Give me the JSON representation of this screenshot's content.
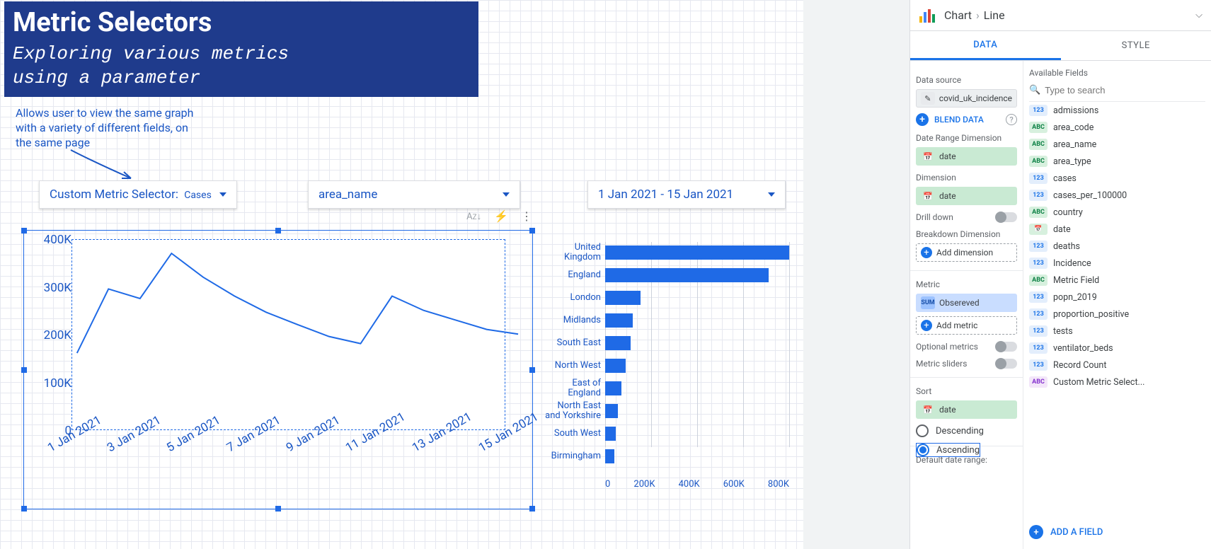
{
  "banner": {
    "title": "Metric Selectors",
    "subtitle_l1": "Exploring various metrics",
    "subtitle_l2": "using a parameter"
  },
  "note": "Allows user to view the same graph with a variety of different fields, on the same page",
  "dropdowns": {
    "metric_label": "Custom Metric Selector:",
    "metric_value": "Cases",
    "area": "area_name",
    "date_range": "1 Jan 2021 - 15 Jan 2021"
  },
  "quick_actions": {
    "sort_az": "AZ",
    "bolt": "⚡",
    "more": "⋮"
  },
  "chart_data": [
    {
      "type": "line",
      "title": "",
      "xlabel": "",
      "ylabel": "",
      "ylim": [
        0,
        400000
      ],
      "y_ticks": [
        "0",
        "100K",
        "200K",
        "300K",
        "400K"
      ],
      "categories": [
        "1 Jan 2021",
        "3 Jan 2021",
        "5 Jan 2021",
        "7 Jan 2021",
        "9 Jan 2021",
        "11 Jan 2021",
        "13 Jan 2021",
        "15 Jan 2021"
      ],
      "values": [
        160000,
        295000,
        275000,
        370000,
        320000,
        280000,
        246000,
        220000,
        195000,
        180000,
        280000,
        250000,
        230000,
        210000,
        200000
      ]
    },
    {
      "type": "bar",
      "orientation": "horizontal",
      "xlim": [
        0,
        800000
      ],
      "x_ticks": [
        "0",
        "200K",
        "400K",
        "600K",
        "800K"
      ],
      "categories": [
        "United Kingdom",
        "England",
        "London",
        "Midlands",
        "South East",
        "North West",
        "East of England",
        "North East and Yorkshire",
        "South West",
        "Birmingham"
      ],
      "values": [
        800000,
        710000,
        155000,
        120000,
        110000,
        88000,
        72000,
        55000,
        45000,
        40000
      ]
    }
  ],
  "panel": {
    "crumb_root": "Chart",
    "crumb_leaf": "Line",
    "tabs": {
      "data": "DATA",
      "style": "STYLE"
    },
    "sections": {
      "data_source": "Data source",
      "ds_value": "covid_uk_incidence",
      "blend": "BLEND DATA",
      "date_range_dim": "Date Range Dimension",
      "date_chip": "date",
      "dimension": "Dimension",
      "dim_chip": "date",
      "drill": "Drill down",
      "breakdown": "Breakdown Dimension",
      "add_dim": "Add dimension",
      "metric": "Metric",
      "metric_badge": "SUM",
      "metric_value": "Obsereved",
      "add_metric": "Add metric",
      "opt_metrics": "Optional metrics",
      "sliders": "Metric sliders",
      "sort": "Sort",
      "sort_chip": "date",
      "desc": "Descending",
      "asc": "Ascending",
      "def_range": "Default date range:"
    },
    "available": {
      "title": "Available Fields",
      "placeholder": "Type to search",
      "add_field": "ADD A FIELD",
      "fields": [
        {
          "badge": "123",
          "class": "b123",
          "name": "admissions"
        },
        {
          "badge": "ABC",
          "class": "bABC",
          "name": "area_code"
        },
        {
          "badge": "ABC",
          "class": "bABC",
          "name": "area_name"
        },
        {
          "badge": "ABC",
          "class": "bABC",
          "name": "area_type"
        },
        {
          "badge": "123",
          "class": "b123",
          "name": "cases"
        },
        {
          "badge": "123",
          "class": "b123",
          "name": "cases_per_100000"
        },
        {
          "badge": "ABC",
          "class": "bABC",
          "name": "country"
        },
        {
          "badge": "CAL",
          "class": "bCAL",
          "name": "date"
        },
        {
          "badge": "123",
          "class": "b123",
          "name": "deaths"
        },
        {
          "badge": "123",
          "class": "b123",
          "name": "Incidence"
        },
        {
          "badge": "ABC",
          "class": "bABC",
          "name": "Metric Field"
        },
        {
          "badge": "123",
          "class": "b123",
          "name": "popn_2019"
        },
        {
          "badge": "123",
          "class": "b123",
          "name": "proportion_positive"
        },
        {
          "badge": "123",
          "class": "b123",
          "name": "tests"
        },
        {
          "badge": "123",
          "class": "b123",
          "name": "ventilator_beds"
        },
        {
          "badge": "123",
          "class": "bREC",
          "name": "Record Count"
        },
        {
          "badge": "ABC",
          "class": "bCUS",
          "name": "Custom Metric Select..."
        }
      ]
    }
  }
}
